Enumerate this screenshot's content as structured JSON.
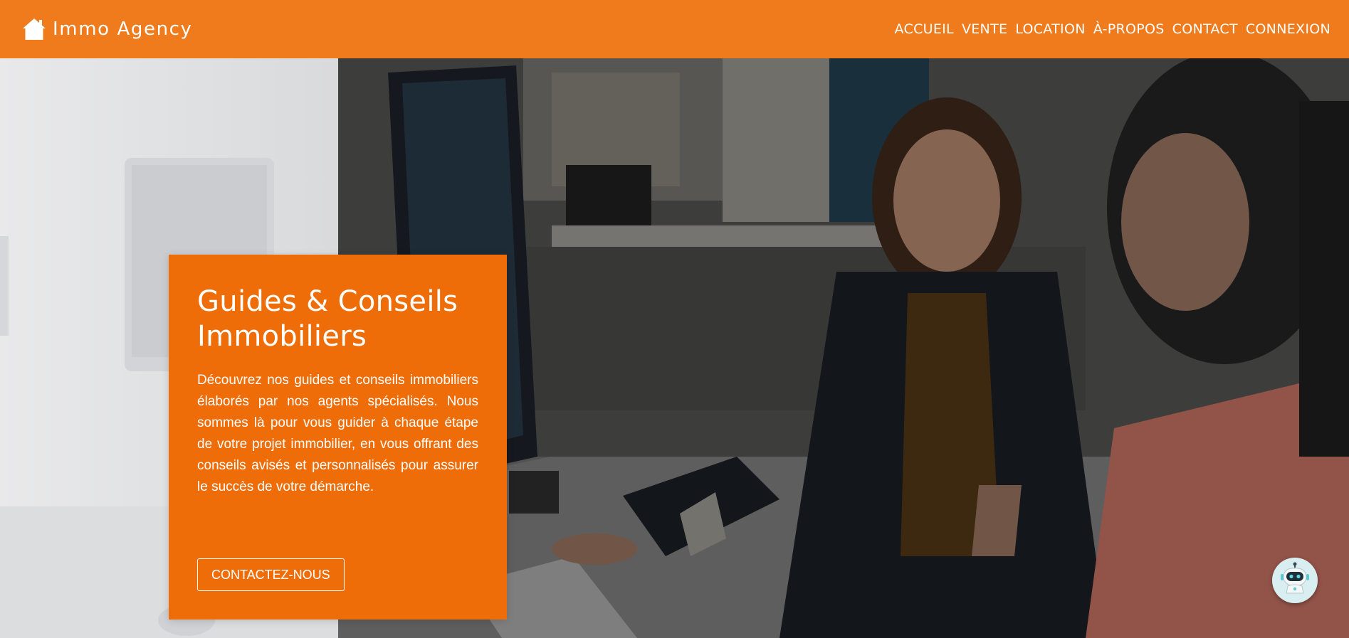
{
  "header": {
    "brand_name": "Immo Agency",
    "brand_icon": "house-icon",
    "nav": [
      {
        "label": "ACCUEIL"
      },
      {
        "label": "VENTE"
      },
      {
        "label": "LOCATION"
      },
      {
        "label": "À-PROPOS"
      },
      {
        "label": "CONTACT"
      },
      {
        "label": "CONNEXION"
      }
    ]
  },
  "hero": {
    "title": "Guides & Conseils Immobiliers",
    "description": "Découvrez nos guides et conseils immobiliers élaborés par nos agents spécialisés. Nous sommes là pour vous guider à chaque étape de votre projet immobilier, en vous offrant des conseils avisés et personnalisés pour assurer le succès de votre démarche.",
    "cta_label": "CONTACTEZ-NOUS",
    "image": "two-women-at-computer-photo"
  },
  "chatbot": {
    "icon": "robot-icon"
  },
  "colors": {
    "header": "#f07b1d",
    "card": "#ef6d08",
    "text_on_accent": "#ffffff"
  }
}
